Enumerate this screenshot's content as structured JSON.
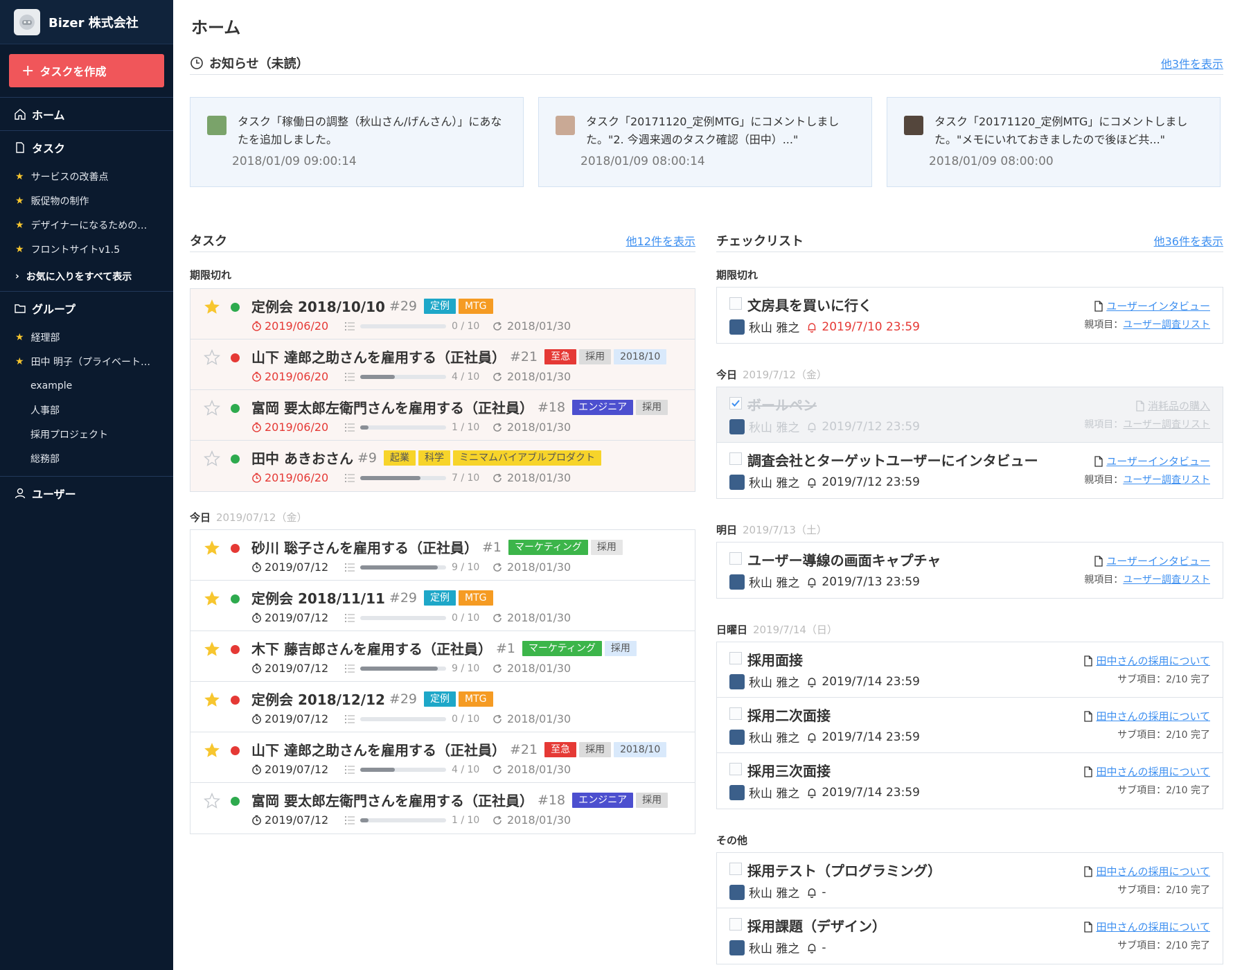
{
  "sidebar": {
    "company": "Bizer 株式会社",
    "create_button": "タスクを作成",
    "nav": {
      "home": "ホーム",
      "task": "タスク",
      "group": "グループ",
      "user": "ユーザー"
    },
    "favorites": [
      "サービスの改善点",
      "販促物の制作",
      "デザイナーになるための…",
      "フロントサイトv1.5"
    ],
    "show_all_favorites": "お気に入りをすべて表示",
    "group_favorites": [
      "経理部",
      "田中 明子（プライベート…"
    ],
    "groups": [
      "example",
      "人事部",
      "採用プロジェクト",
      "総務部"
    ]
  },
  "main": {
    "title": "ホーム",
    "notices": {
      "heading": "お知らせ（未読）",
      "more": "他3件を表示",
      "items": [
        {
          "message": "タスク「稼働日の調整（秋山さん/げんさん）」にあなたを追加しました。",
          "time": "2018/01/09 09:00:14"
        },
        {
          "message": "タスク「20171120_定例MTG」にコメントしました。\"2. 今週来週のタスク確認（田中）...\"",
          "time": "2018/01/09 08:00:14"
        },
        {
          "message": "タスク「20171120_定例MTG」にコメントしました。\"メモにいれておきましたので後ほど共...\"",
          "time": "2018/01/09 08:00:00"
        }
      ]
    },
    "tasks": {
      "heading": "タスク",
      "more": "他12件を表示",
      "overdue_label": "期限切れ",
      "today_label": "今日",
      "today_date": "2019/07/12（金）",
      "overdue": [
        {
          "title": "定例会 2018/10/10",
          "num": "#29",
          "starred": true,
          "dot": "#2eaa4e",
          "tags": [
            {
              "text": "定例",
              "bg": "#1ea7c8",
              "fg": "#ffffff"
            },
            {
              "text": "MTG",
              "bg": "#f59b23",
              "fg": "#ffffff"
            }
          ],
          "due": "2019/06/20",
          "progress": 0,
          "count": "0 / 10",
          "updated": "2018/01/30"
        },
        {
          "title": "山下 達郎之助さんを雇用する（正社員）",
          "num": "#21",
          "starred": false,
          "dot": "#e53935",
          "tags": [
            {
              "text": "至急",
              "bg": "#e53935",
              "fg": "#ffffff"
            },
            {
              "text": "採用",
              "bg": "#dcdcdc",
              "fg": "#555555"
            },
            {
              "text": "2018/10",
              "bg": "#d9e9fb",
              "fg": "#555555"
            }
          ],
          "due": "2019/06/20",
          "progress": 0.4,
          "count": "4 / 10",
          "updated": "2018/01/30"
        },
        {
          "title": "富岡 要太郎左衛門さんを雇用する（正社員）",
          "num": "#18",
          "starred": false,
          "dot": "#2eaa4e",
          "tags": [
            {
              "text": "エンジニア",
              "bg": "#4c4fcf",
              "fg": "#ffffff"
            },
            {
              "text": "採用",
              "bg": "#dcdcdc",
              "fg": "#555555"
            }
          ],
          "due": "2019/06/20",
          "progress": 0.1,
          "count": "1 / 10",
          "updated": "2018/01/30"
        },
        {
          "title": "田中 あきおさん",
          "num": "#9",
          "starred": false,
          "dot": "#2eaa4e",
          "tags": [
            {
              "text": "起業",
              "bg": "#f7d42a",
              "fg": "#555555"
            },
            {
              "text": "科学",
              "bg": "#f7d42a",
              "fg": "#555555"
            },
            {
              "text": "ミニマムバイアブルプロダクト",
              "bg": "#f7d42a",
              "fg": "#555555"
            }
          ],
          "due": "2019/06/20",
          "progress": 0.7,
          "count": "7 / 10",
          "updated": "2018/01/30"
        }
      ],
      "today": [
        {
          "title": "砂川 聡子さんを雇用する（正社員）",
          "num": "#1",
          "starred": true,
          "dot": "#e53935",
          "tags": [
            {
              "text": "マーケティング",
              "bg": "#3cb54a",
              "fg": "#ffffff"
            },
            {
              "text": "採用",
              "bg": "#e6e6e6",
              "fg": "#555555"
            }
          ],
          "due": "2019/07/12",
          "progress": 0.9,
          "count": "9 / 10",
          "updated": "2018/01/30"
        },
        {
          "title": "定例会 2018/11/11",
          "num": "#29",
          "starred": true,
          "dot": "#2eaa4e",
          "tags": [
            {
              "text": "定例",
              "bg": "#1ea7c8",
              "fg": "#ffffff"
            },
            {
              "text": "MTG",
              "bg": "#f59b23",
              "fg": "#ffffff"
            }
          ],
          "due": "2019/07/12",
          "progress": 0,
          "count": "0 / 10",
          "updated": "2018/01/30"
        },
        {
          "title": "木下 藤吉郎さんを雇用する（正社員）",
          "num": "#1",
          "starred": true,
          "dot": "#e53935",
          "tags": [
            {
              "text": "マーケティング",
              "bg": "#3cb54a",
              "fg": "#ffffff"
            },
            {
              "text": "採用",
              "bg": "#d9e9fb",
              "fg": "#555555"
            }
          ],
          "due": "2019/07/12",
          "progress": 0.9,
          "count": "9 / 10",
          "updated": "2018/01/30"
        },
        {
          "title": "定例会 2018/12/12",
          "num": "#29",
          "starred": true,
          "dot": "#e53935",
          "tags": [
            {
              "text": "定例",
              "bg": "#1ea7c8",
              "fg": "#ffffff"
            },
            {
              "text": "MTG",
              "bg": "#f59b23",
              "fg": "#ffffff"
            }
          ],
          "due": "2019/07/12",
          "progress": 0,
          "count": "0 / 10",
          "updated": "2018/01/30"
        },
        {
          "title": "山下 達郎之助さんを雇用する（正社員）",
          "num": "#21",
          "starred": true,
          "dot": "#e53935",
          "tags": [
            {
              "text": "至急",
              "bg": "#e53935",
              "fg": "#ffffff"
            },
            {
              "text": "採用",
              "bg": "#dcdcdc",
              "fg": "#555555"
            },
            {
              "text": "2018/10",
              "bg": "#d9e9fb",
              "fg": "#555555"
            }
          ],
          "due": "2019/07/12",
          "progress": 0.4,
          "count": "4 / 10",
          "updated": "2018/01/30"
        },
        {
          "title": "富岡 要太郎左衛門さんを雇用する（正社員）",
          "num": "#18",
          "starred": false,
          "dot": "#2eaa4e",
          "tags": [
            {
              "text": "エンジニア",
              "bg": "#4c4fcf",
              "fg": "#ffffff"
            },
            {
              "text": "採用",
              "bg": "#dcdcdc",
              "fg": "#555555"
            }
          ],
          "due": "2019/07/12",
          "progress": 0.1,
          "count": "1 / 10",
          "updated": "2018/01/30"
        }
      ]
    },
    "checklist": {
      "heading": "チェックリスト",
      "more": "他36件を表示",
      "groups": [
        {
          "label": "期限切れ",
          "date": "",
          "items": [
            {
              "title": "文房具を買いに行く",
              "done": false,
              "user": "秋山 雅之",
              "deadline": "2019/7/10 23:59",
              "overdue": true,
              "link": "ユーザーインタビュー",
              "sub_label": "親項目：",
              "sub_link": "ユーザー調査リスト",
              "sub_text": ""
            }
          ]
        },
        {
          "label": "今日",
          "date": "2019/7/12（金）",
          "items": [
            {
              "title": "ボールペン",
              "done": true,
              "user": "秋山 雅之",
              "deadline": "2019/7/12 23:59",
              "overdue": false,
              "link": "消耗品の購入",
              "sub_label": "親項目：",
              "sub_link": "ユーザー調査リスト",
              "sub_text": ""
            },
            {
              "title": "調査会社とターゲットユーザーにインタビュー",
              "done": false,
              "user": "秋山 雅之",
              "deadline": "2019/7/12 23:59",
              "overdue": false,
              "link": "ユーザーインタビュー",
              "sub_label": "親項目：",
              "sub_link": "ユーザー調査リスト",
              "sub_text": ""
            }
          ]
        },
        {
          "label": "明日",
          "date": "2019/7/13（土）",
          "items": [
            {
              "title": "ユーザー導線の画面キャプチャ",
              "done": false,
              "user": "秋山 雅之",
              "deadline": "2019/7/13 23:59",
              "overdue": false,
              "link": "ユーザーインタビュー",
              "sub_label": "親項目：",
              "sub_link": "ユーザー調査リスト",
              "sub_text": ""
            }
          ]
        },
        {
          "label": "日曜日",
          "date": "2019/7/14（日）",
          "items": [
            {
              "title": "採用面接",
              "done": false,
              "user": "秋山 雅之",
              "deadline": "2019/7/14 23:59",
              "overdue": false,
              "link": "田中さんの採用について",
              "sub_label": "",
              "sub_link": "",
              "sub_text": "サブ項目：2/10 完了"
            },
            {
              "title": "採用二次面接",
              "done": false,
              "user": "秋山 雅之",
              "deadline": "2019/7/14 23:59",
              "overdue": false,
              "link": "田中さんの採用について",
              "sub_label": "",
              "sub_link": "",
              "sub_text": "サブ項目：2/10 完了"
            },
            {
              "title": "採用三次面接",
              "done": false,
              "user": "秋山 雅之",
              "deadline": "2019/7/14 23:59",
              "overdue": false,
              "link": "田中さんの採用について",
              "sub_label": "",
              "sub_link": "",
              "sub_text": "サブ項目：2/10 完了"
            }
          ]
        },
        {
          "label": "その他",
          "date": "",
          "items": [
            {
              "title": "採用テスト（プログラミング）",
              "done": false,
              "user": "秋山 雅之",
              "deadline": "-",
              "overdue": false,
              "link": "田中さんの採用について",
              "sub_label": "",
              "sub_link": "",
              "sub_text": "サブ項目：2/10 完了"
            },
            {
              "title": "採用課題（デザイン）",
              "done": false,
              "user": "秋山 雅之",
              "deadline": "-",
              "overdue": false,
              "link": "田中さんの採用について",
              "sub_label": "",
              "sub_link": "",
              "sub_text": "サブ項目：2/10 完了"
            }
          ]
        }
      ]
    }
  }
}
